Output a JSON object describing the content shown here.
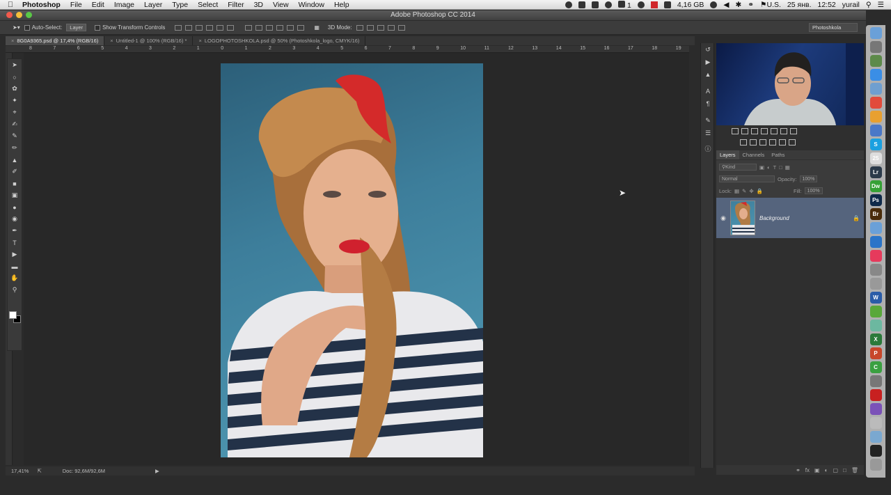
{
  "menubar": {
    "app": "Photoshop",
    "items": [
      "File",
      "Edit",
      "Image",
      "Layer",
      "Type",
      "Select",
      "Filter",
      "3D",
      "View",
      "Window",
      "Help"
    ],
    "tray": {
      "memory": "4,16 GB",
      "layout": "U.S.",
      "date": "25 янв.",
      "time": "12:52",
      "user": "yurail",
      "counter": "1"
    }
  },
  "window": {
    "title": "Adobe Photoshop CC 2014"
  },
  "options": {
    "auto_select_label": "Auto-Select:",
    "auto_select_value": "Layer",
    "transform_label": "Show Transform Controls",
    "mode3d_label": "3D Mode:",
    "workspace": "Photoshkola"
  },
  "tabs": [
    {
      "label": "8G0A9365.psd @ 17,4% (RGB/16)",
      "active": true
    },
    {
      "label": "Untitled-1 @ 100% (RGB/16) *",
      "active": false
    },
    {
      "label": "LOGOPHOTOSHKOLA.psd @ 50% (Photoshkola_logo, CMYK/16)",
      "active": false
    }
  ],
  "ruler": [
    "8",
    "7",
    "6",
    "5",
    "4",
    "3",
    "2",
    "1",
    "0",
    "1",
    "2",
    "3",
    "4",
    "5",
    "6",
    "7",
    "8",
    "9",
    "10",
    "11",
    "12",
    "13",
    "14",
    "15",
    "16",
    "17",
    "18",
    "19"
  ],
  "status": {
    "zoom": "17,41%",
    "doc": "Doc: 92,6M/92,6M"
  },
  "panels": {
    "tabs": [
      "Layers",
      "Channels",
      "Paths"
    ],
    "kind": "Kind",
    "blend": "Normal",
    "opacity_label": "Opacity:",
    "opacity_value": "100%",
    "lock_label": "Lock:",
    "fill_label": "Fill:",
    "fill_value": "100%",
    "layer_name": "Background"
  },
  "dock": [
    {
      "icon": "finder-icon",
      "color": "#6aa0d8",
      "glyph": ""
    },
    {
      "icon": "launchpad-icon",
      "color": "#777777",
      "glyph": ""
    },
    {
      "icon": "preview-icon",
      "color": "#5d8a4a",
      "glyph": ""
    },
    {
      "icon": "safari-icon",
      "color": "#3a8ee6",
      "glyph": ""
    },
    {
      "icon": "mail-icon",
      "color": "#6f9fd0",
      "glyph": ""
    },
    {
      "icon": "chrome-icon",
      "color": "#e24b3b",
      "glyph": ""
    },
    {
      "icon": "chrome-canary-icon",
      "color": "#e8a030",
      "glyph": ""
    },
    {
      "icon": "chrome-dev-icon",
      "color": "#4a78c8",
      "glyph": ""
    },
    {
      "icon": "skype-icon",
      "color": "#1ba0e0",
      "glyph": "S"
    },
    {
      "icon": "calendar-icon",
      "color": "#dddddd",
      "glyph": "25"
    },
    {
      "icon": "lightroom-icon",
      "color": "#2b3a4a",
      "glyph": "Lr"
    },
    {
      "icon": "dreamweaver-icon",
      "color": "#35a135",
      "glyph": "Dw"
    },
    {
      "icon": "photoshop-icon",
      "color": "#0f2a4a",
      "glyph": "Ps"
    },
    {
      "icon": "bridge-icon",
      "color": "#4a2c0a",
      "glyph": "Br"
    },
    {
      "icon": "finder2-icon",
      "color": "#6aa0d8",
      "glyph": ""
    },
    {
      "icon": "app-store-icon",
      "color": "#2a74c8",
      "glyph": ""
    },
    {
      "icon": "itunes-icon",
      "color": "#e63a5c",
      "glyph": ""
    },
    {
      "icon": "system-prefs-icon",
      "color": "#888888",
      "glyph": ""
    },
    {
      "icon": "script-editor-icon",
      "color": "#999999",
      "glyph": ""
    },
    {
      "icon": "word-icon",
      "color": "#2a5ca8",
      "glyph": "W"
    },
    {
      "icon": "evernote-icon",
      "color": "#59a83a",
      "glyph": ""
    },
    {
      "icon": "maps-icon",
      "color": "#6cb8a0",
      "glyph": ""
    },
    {
      "icon": "excel-icon",
      "color": "#2b7a3a",
      "glyph": "X"
    },
    {
      "icon": "powerpoint-icon",
      "color": "#c8462a",
      "glyph": "P"
    },
    {
      "icon": "camtasia-icon",
      "color": "#3aa040",
      "glyph": "C"
    },
    {
      "icon": "utilities-icon",
      "color": "#777777",
      "glyph": ""
    },
    {
      "icon": "acrobat-icon",
      "color": "#c82020",
      "glyph": ""
    },
    {
      "icon": "viber-icon",
      "color": "#7b52b8",
      "glyph": ""
    },
    {
      "icon": "downloads-icon",
      "color": "#bbbbbb",
      "glyph": ""
    },
    {
      "icon": "folder-icon",
      "color": "#7aa8d0",
      "glyph": ""
    },
    {
      "icon": "terminal-icon",
      "color": "#222222",
      "glyph": ""
    },
    {
      "icon": "trash-icon",
      "color": "#999999",
      "glyph": ""
    }
  ]
}
